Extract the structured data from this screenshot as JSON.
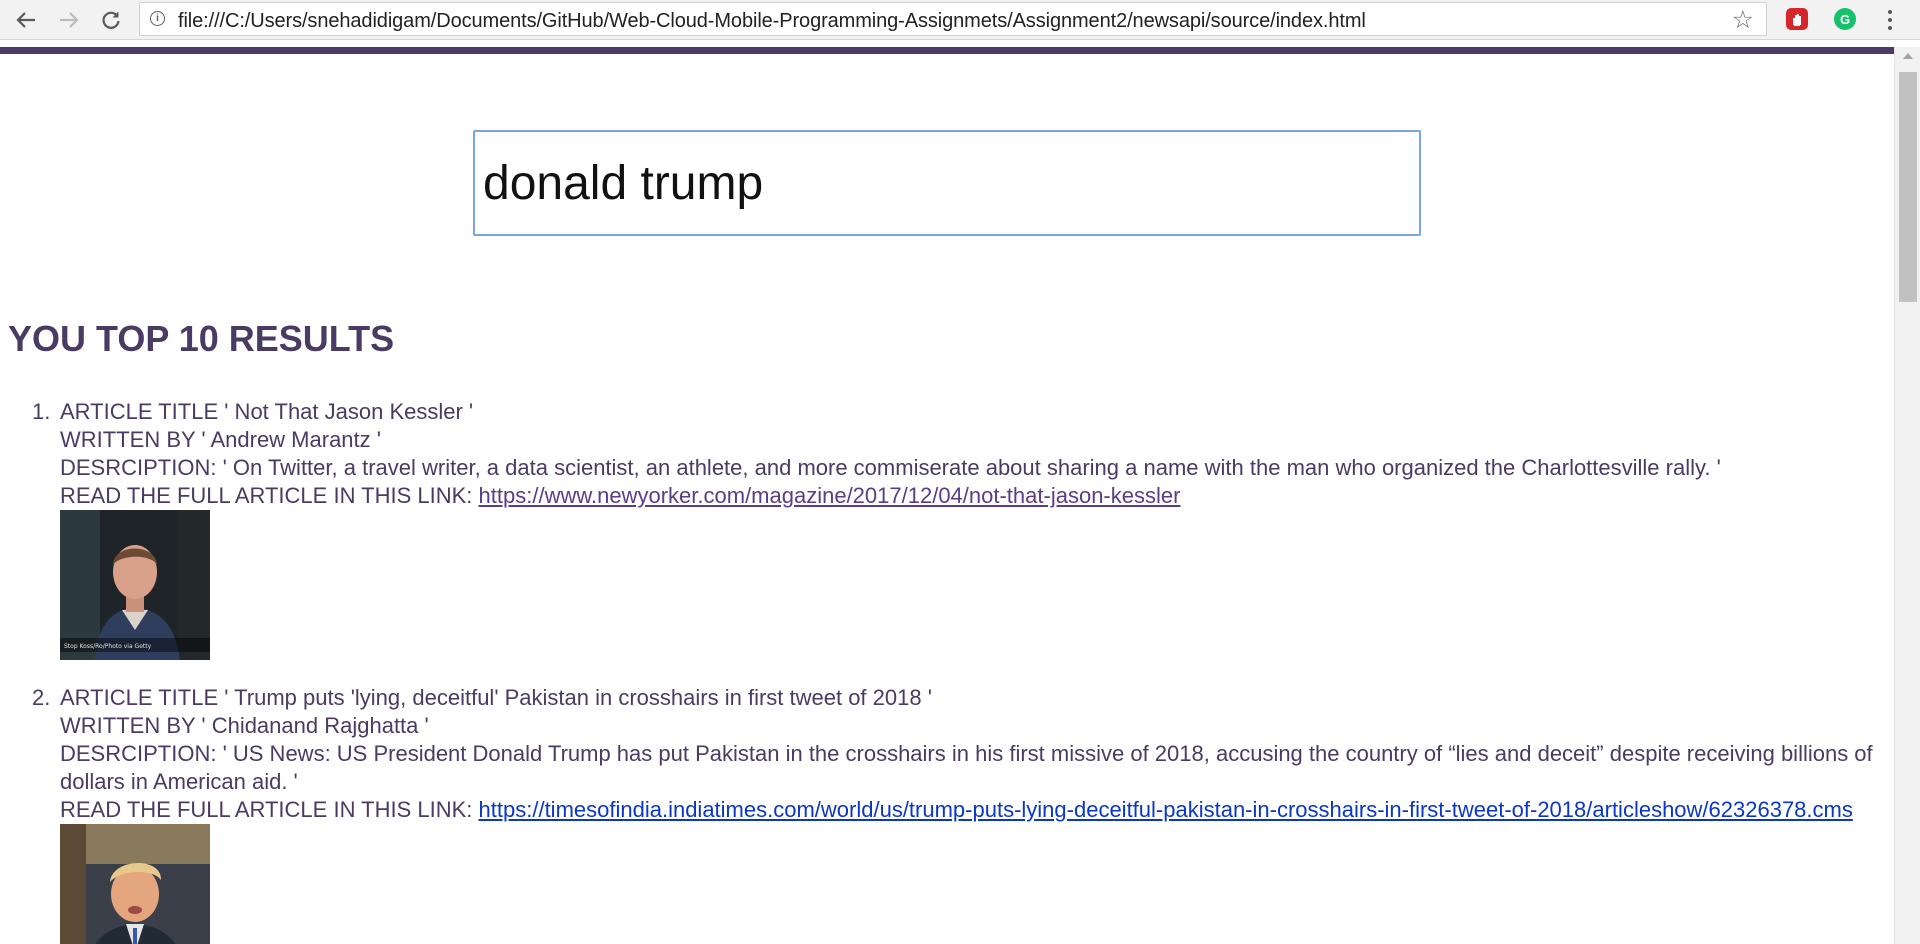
{
  "browser": {
    "url": "file:///C:/Users/snehadidigam/Documents/GitHub/Web-Cloud-Mobile-Programming-Assignmets/Assignment2/newsapi/source/index.html",
    "back_icon": "arrow-left-icon",
    "forward_icon": "arrow-right-icon",
    "reload_icon": "reload-icon",
    "bookmark_icon": "star-icon",
    "accent_color": "#4a3b64"
  },
  "search": {
    "value": "donald trump"
  },
  "results": {
    "heading": "YOU TOP 10 RESULTS",
    "articles": [
      {
        "number": "1.",
        "title_line": "ARTICLE TITLE ' Not That Jason Kessler '",
        "author_line": "WRITTEN BY ' Andrew Marantz '",
        "description_line": "DESRCIPTION: ' On Twitter, a travel writer, a data scientist, an athlete, and more commiserate about sharing a name with the man who organized the Charlottesville rally. '",
        "link_prefix": "READ THE FULL ARTICLE IN THIS LINK: ",
        "link": "https://www.newyorker.com/magazine/2017/12/04/not-that-jason-kessler",
        "image_caption": "Stop Koss/Ro/Photo via Getty"
      },
      {
        "number": "2.",
        "title_line": "ARTICLE TITLE ' Trump puts 'lying, deceitful' Pakistan in crosshairs in first tweet of 2018 '",
        "author_line": "WRITTEN BY ' Chidanand Rajghatta '",
        "description_line": "DESRCIPTION: ' US News: US President Donald Trump has put Pakistan in the crosshairs in his first missive of 2018, accusing the country of “lies and deceit” despite receiving billions of dollars in American aid. '",
        "link_prefix": "READ THE FULL ARTICLE IN THIS LINK: ",
        "link": "https://timesofindia.indiatimes.com/world/us/trump-puts-lying-deceitful-pakistan-in-crosshairs-in-first-tweet-of-2018/articleshow/62326378.cms"
      }
    ]
  }
}
